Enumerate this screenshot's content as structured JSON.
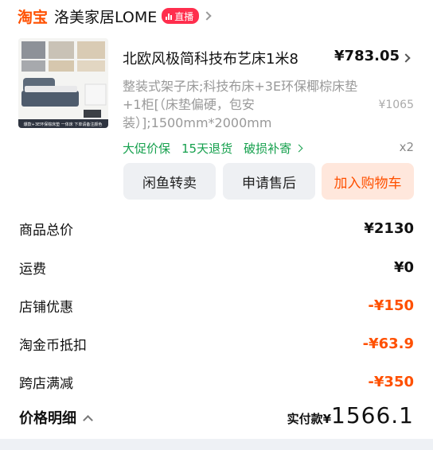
{
  "shop": {
    "platform_logo": "淘宝",
    "name": "洛美家居LOME",
    "live_badge": "直播",
    "chevron_icon": "chevron-right-icon"
  },
  "item": {
    "thumbnail_caption": "爆款+3E环保棕床垫 一体床 下单请备注颜色",
    "title": "北欧风极简科技布艺床1米8",
    "price": "¥783.05",
    "spec": "整装式架子床;科技布床+3E环保椰棕床垫+1柜[（床垫偏硬，包安装）];1500mm*2000mm",
    "original_price": "¥1065",
    "services": [
      "大促价保",
      "15天退货",
      "破损补寄"
    ],
    "quantity": "x2",
    "colors": {
      "service_green": "#15a04d",
      "accent": "#ff5000"
    }
  },
  "actions": {
    "xianyu": "闲鱼转卖",
    "aftersale": "申请售后",
    "add_to_cart": "加入购物车"
  },
  "summary": [
    {
      "label": "商品总价",
      "value": "¥2130",
      "discount": false
    },
    {
      "label": "运费",
      "value": "¥0",
      "discount": false
    },
    {
      "label": "店铺优惠",
      "value": "-¥150",
      "discount": true
    },
    {
      "label": "淘金币抵扣",
      "value": "-¥63.9",
      "discount": true
    },
    {
      "label": "跨店满减",
      "value": "-¥350",
      "discount": true
    }
  ],
  "footer": {
    "price_detail": "价格明细",
    "paid_label": "实付款¥",
    "paid_amount": "1566.1"
  }
}
